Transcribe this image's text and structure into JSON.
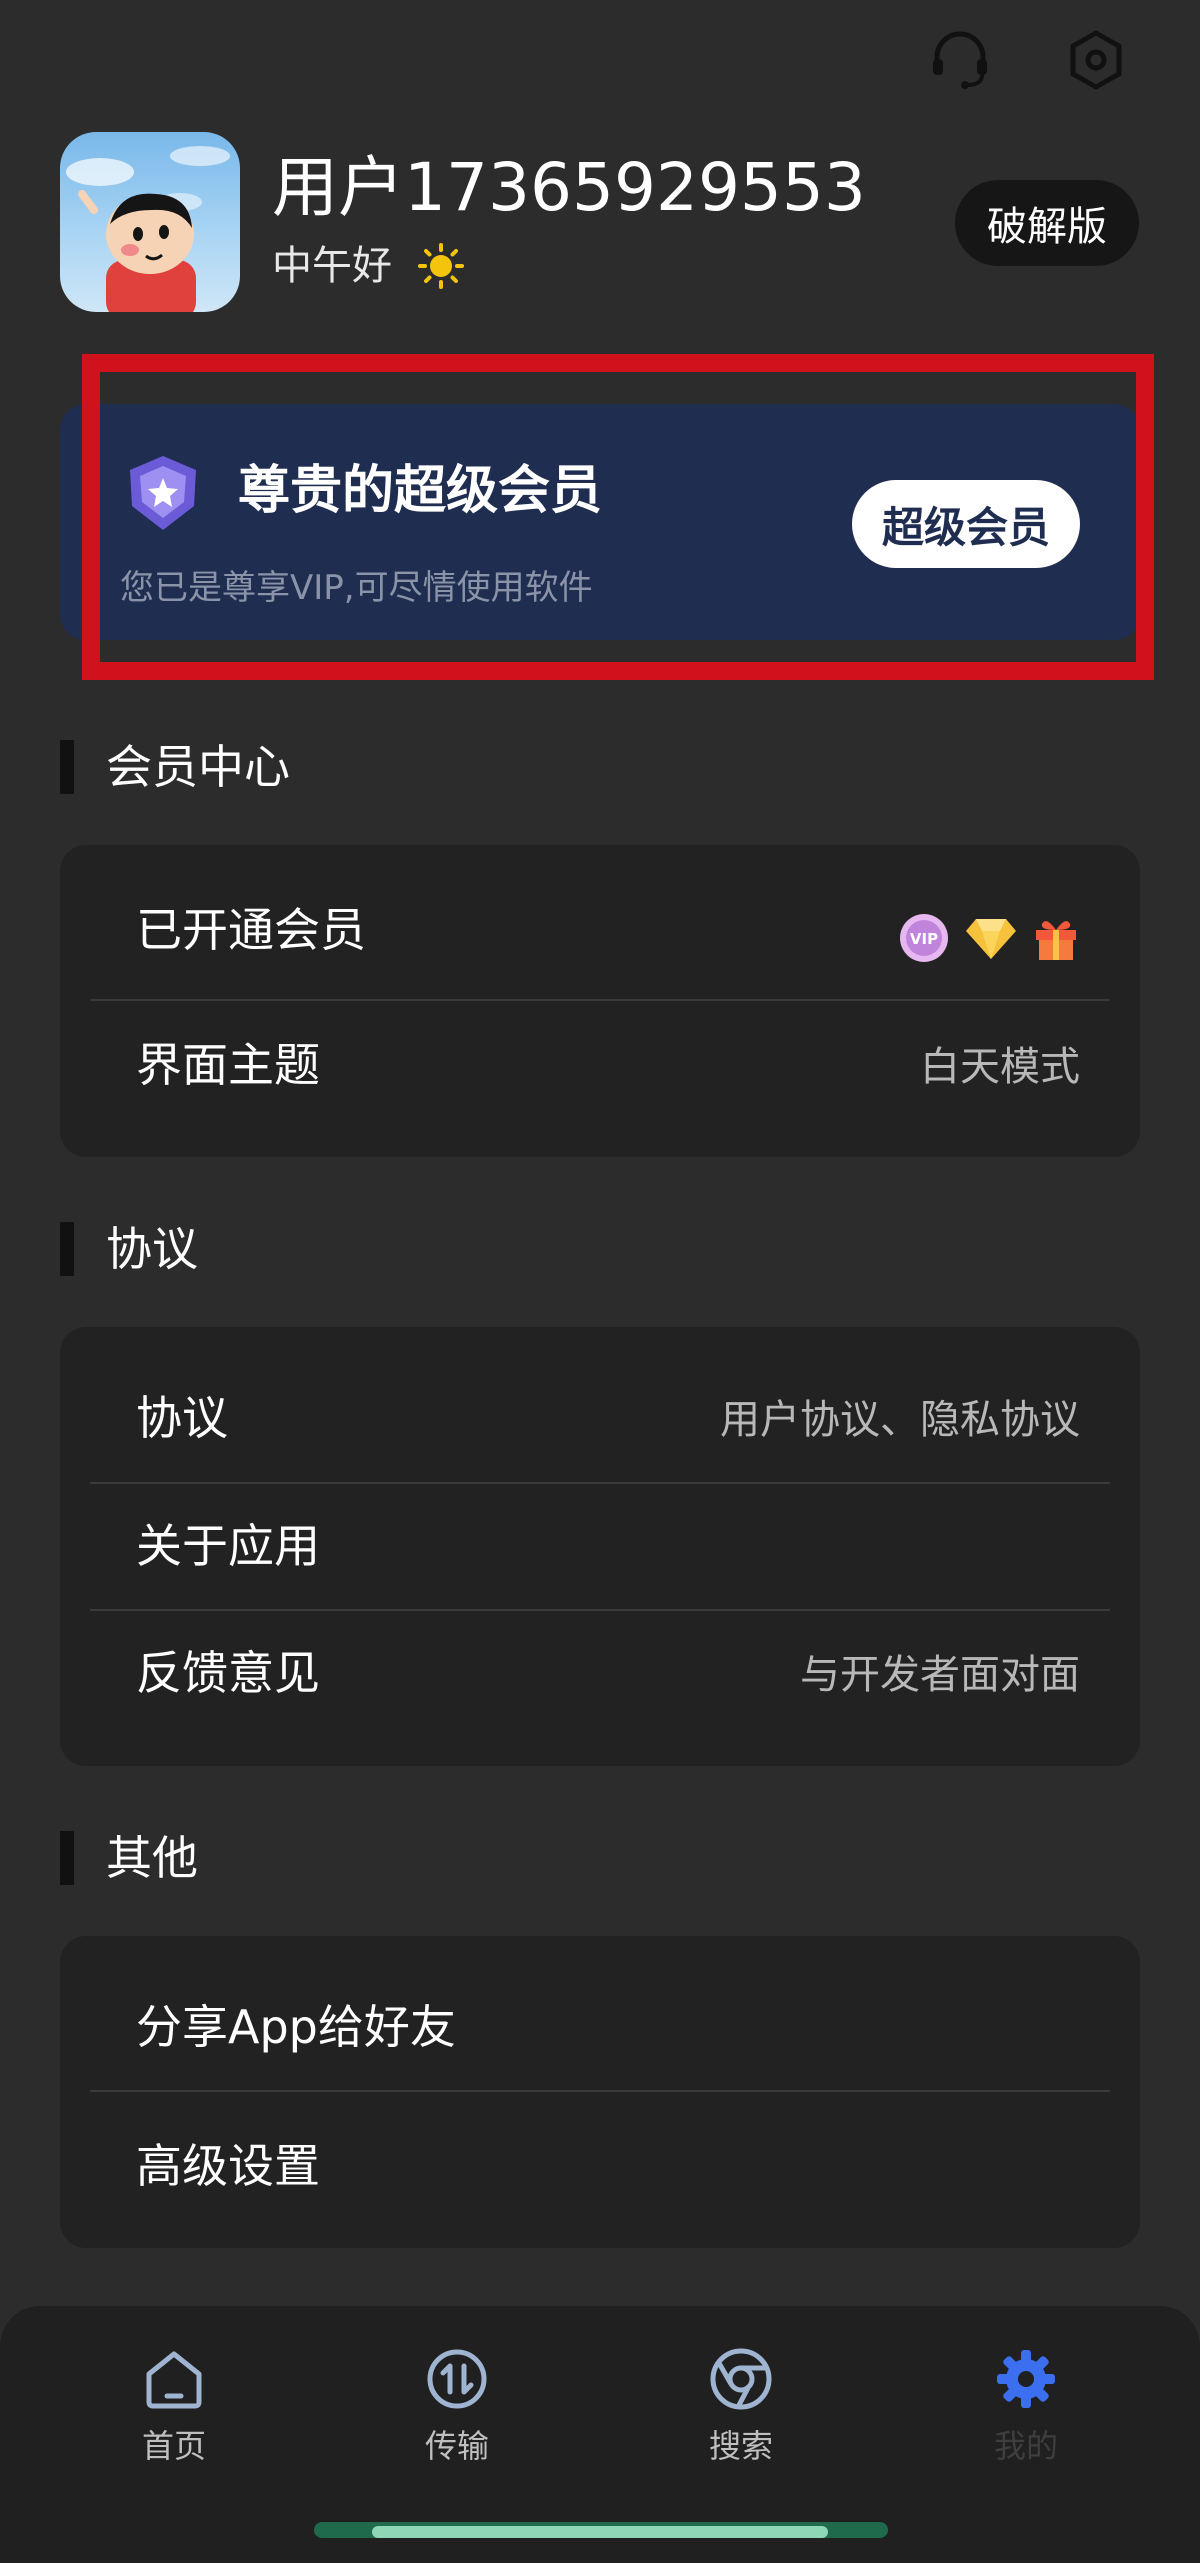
{
  "header": {
    "username": "用户17365929553",
    "greeting": "中午好",
    "crack_label": "破解版",
    "icons": {
      "support": "headset-icon",
      "settings": "hex-settings-icon",
      "weather": "sun-icon"
    }
  },
  "vip_card": {
    "title": "尊贵的超级会员",
    "subtitle": "您已是尊享VIP,可尽情使用软件",
    "button": "超级会员",
    "badge_icon": "shield-star-icon",
    "colors": {
      "card": "#1f2d50",
      "highlight": "#d0121d"
    }
  },
  "sections": {
    "membership": {
      "title": "会员中心",
      "rows": [
        {
          "label": "已开通会员",
          "value": "",
          "badges": [
            "vip-badge-icon",
            "diamond-icon",
            "gift-icon"
          ]
        },
        {
          "label": "界面主题",
          "value": "白天模式"
        }
      ]
    },
    "agreement": {
      "title": "协议",
      "rows": [
        {
          "label": "协议",
          "value": "用户协议、隐私协议"
        },
        {
          "label": "关于应用",
          "value": ""
        },
        {
          "label": "反馈意见",
          "value": "与开发者面对面"
        }
      ]
    },
    "other": {
      "title": "其他",
      "rows": [
        {
          "label": "分享App给好友",
          "value": ""
        },
        {
          "label": "高级设置",
          "value": ""
        }
      ]
    }
  },
  "nav": {
    "items": [
      {
        "label": "首页",
        "icon": "home-icon"
      },
      {
        "label": "传输",
        "icon": "transfer-icon"
      },
      {
        "label": "搜索",
        "icon": "browser-icon"
      },
      {
        "label": "我的",
        "icon": "gear-icon",
        "active": true
      }
    ],
    "active_color": "#3b6ff0"
  }
}
